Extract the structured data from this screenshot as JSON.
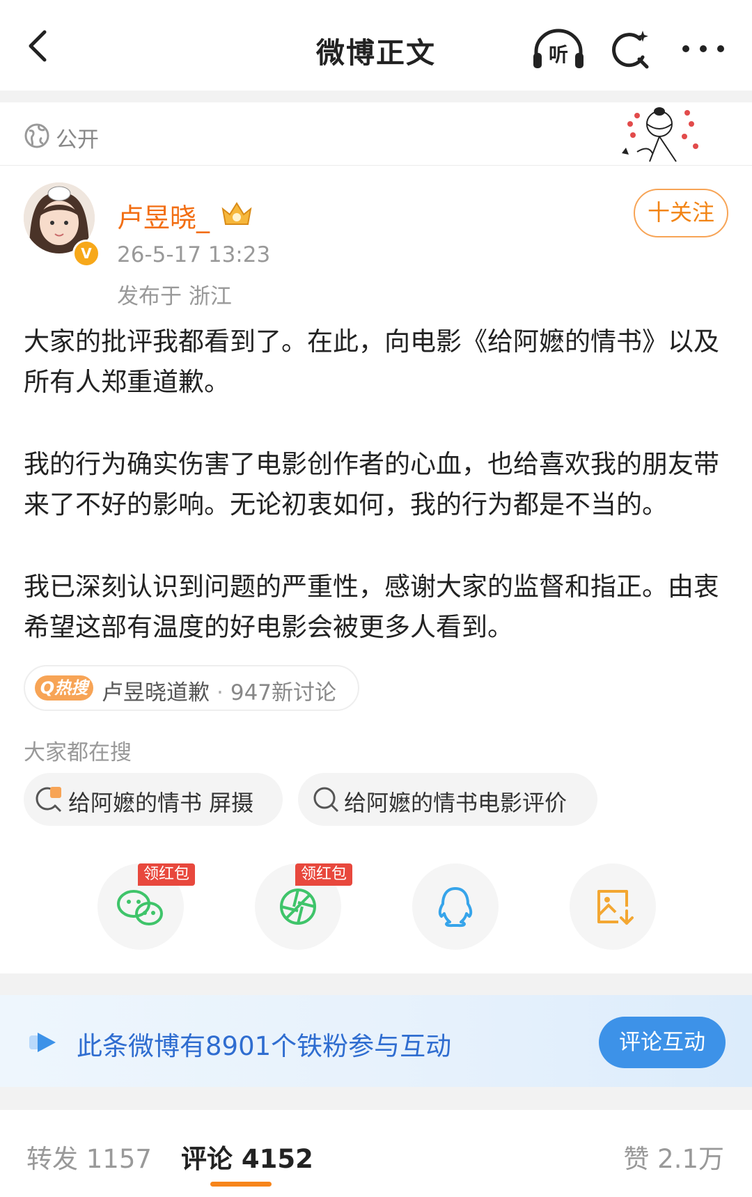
{
  "header": {
    "title": "微博正文",
    "listen_label": "听"
  },
  "visibility": {
    "label": "公开"
  },
  "author": {
    "name": "卢昱晓_",
    "verified_mark": "V",
    "time": "26-5-17 13:23",
    "location": "发布于 浙江",
    "follow_label": "十关注"
  },
  "post": {
    "paragraphs": [
      "大家的批评我都看到了。在此，向电影《给阿嬷的情书》以及所有人郑重道歉。",
      "我的行为确实伤害了电影创作者的心血，也给喜欢我的朋友带来了不好的影响。无论初衷如何，我的行为都是不当的。",
      "我已深刻认识到问题的严重性，感谢大家的监督和指正。由衷希望这部有温度的好电影会被更多人看到。"
    ]
  },
  "hot_search": {
    "tag": "Q热搜",
    "topic": "卢昱晓道歉",
    "separator": "·",
    "count": "947新讨论"
  },
  "everyone_search": {
    "label": "大家都在搜",
    "items": [
      {
        "text": "给阿嬷的情书 屏摄",
        "icon": "hot-search-icon"
      },
      {
        "text": "给阿嬷的情书电影评价",
        "icon": "search-icon"
      }
    ]
  },
  "share": {
    "items": [
      {
        "icon": "wechat-icon",
        "badge": "领红包",
        "color": "#3fc46a"
      },
      {
        "icon": "moments-icon",
        "badge": "领红包",
        "color": "#3fc46a"
      },
      {
        "icon": "qq-icon",
        "color": "#36a4ea"
      },
      {
        "icon": "save-image-icon",
        "color": "#f3a732"
      }
    ]
  },
  "banner": {
    "text": "此条微博有8901个铁粉参与互动",
    "button": "评论互动"
  },
  "tabs": {
    "repost": "转发 1157",
    "comments": "评论 4152",
    "likes": "赞 2.1万"
  }
}
